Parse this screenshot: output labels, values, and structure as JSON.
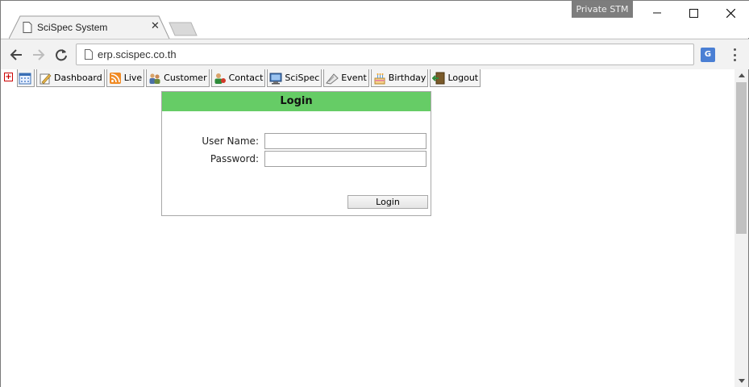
{
  "browser": {
    "profile_label": "Private STM",
    "tab_title": "SciSpec System",
    "url": "erp.scispec.co.th"
  },
  "nav": {
    "items": [
      {
        "label": "Dashboard",
        "icon": "dashboard-icon"
      },
      {
        "label": "Live",
        "icon": "rss-icon"
      },
      {
        "label": "Customer",
        "icon": "customer-icon"
      },
      {
        "label": "Contact",
        "icon": "contact-icon"
      },
      {
        "label": "SciSpec",
        "icon": "monitor-icon"
      },
      {
        "label": "Event",
        "icon": "event-icon"
      },
      {
        "label": "Birthday",
        "icon": "cake-icon"
      },
      {
        "label": "Logout",
        "icon": "logout-icon"
      }
    ]
  },
  "login": {
    "title": "Login",
    "username_label": "User Name:",
    "password_label": "Password:",
    "username_value": "",
    "password_value": "",
    "submit_label": "Login"
  },
  "colors": {
    "login_header": "#66cc66",
    "profile_badge": "#7d7d7d"
  }
}
